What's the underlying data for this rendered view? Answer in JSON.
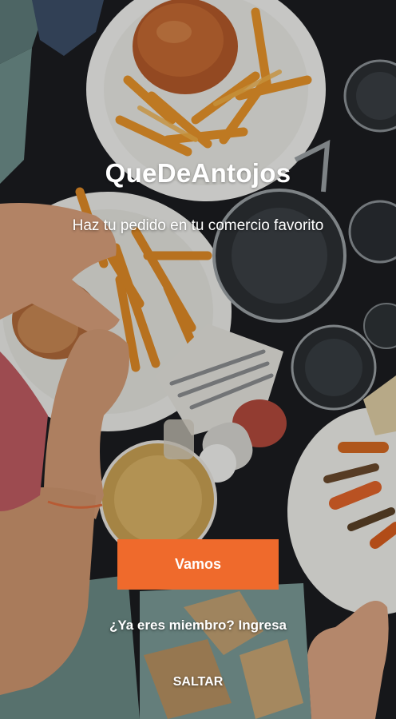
{
  "app": {
    "title": "QueDeAntojos",
    "tagline": "Haz tu pedido en tu comercio favorito"
  },
  "actions": {
    "primary_label": "Vamos",
    "login_prompt": "¿Ya eres miembro? Ingresa",
    "skip_label": "SALTAR"
  },
  "colors": {
    "accent": "#ef6a2c",
    "text": "#ffffff"
  }
}
